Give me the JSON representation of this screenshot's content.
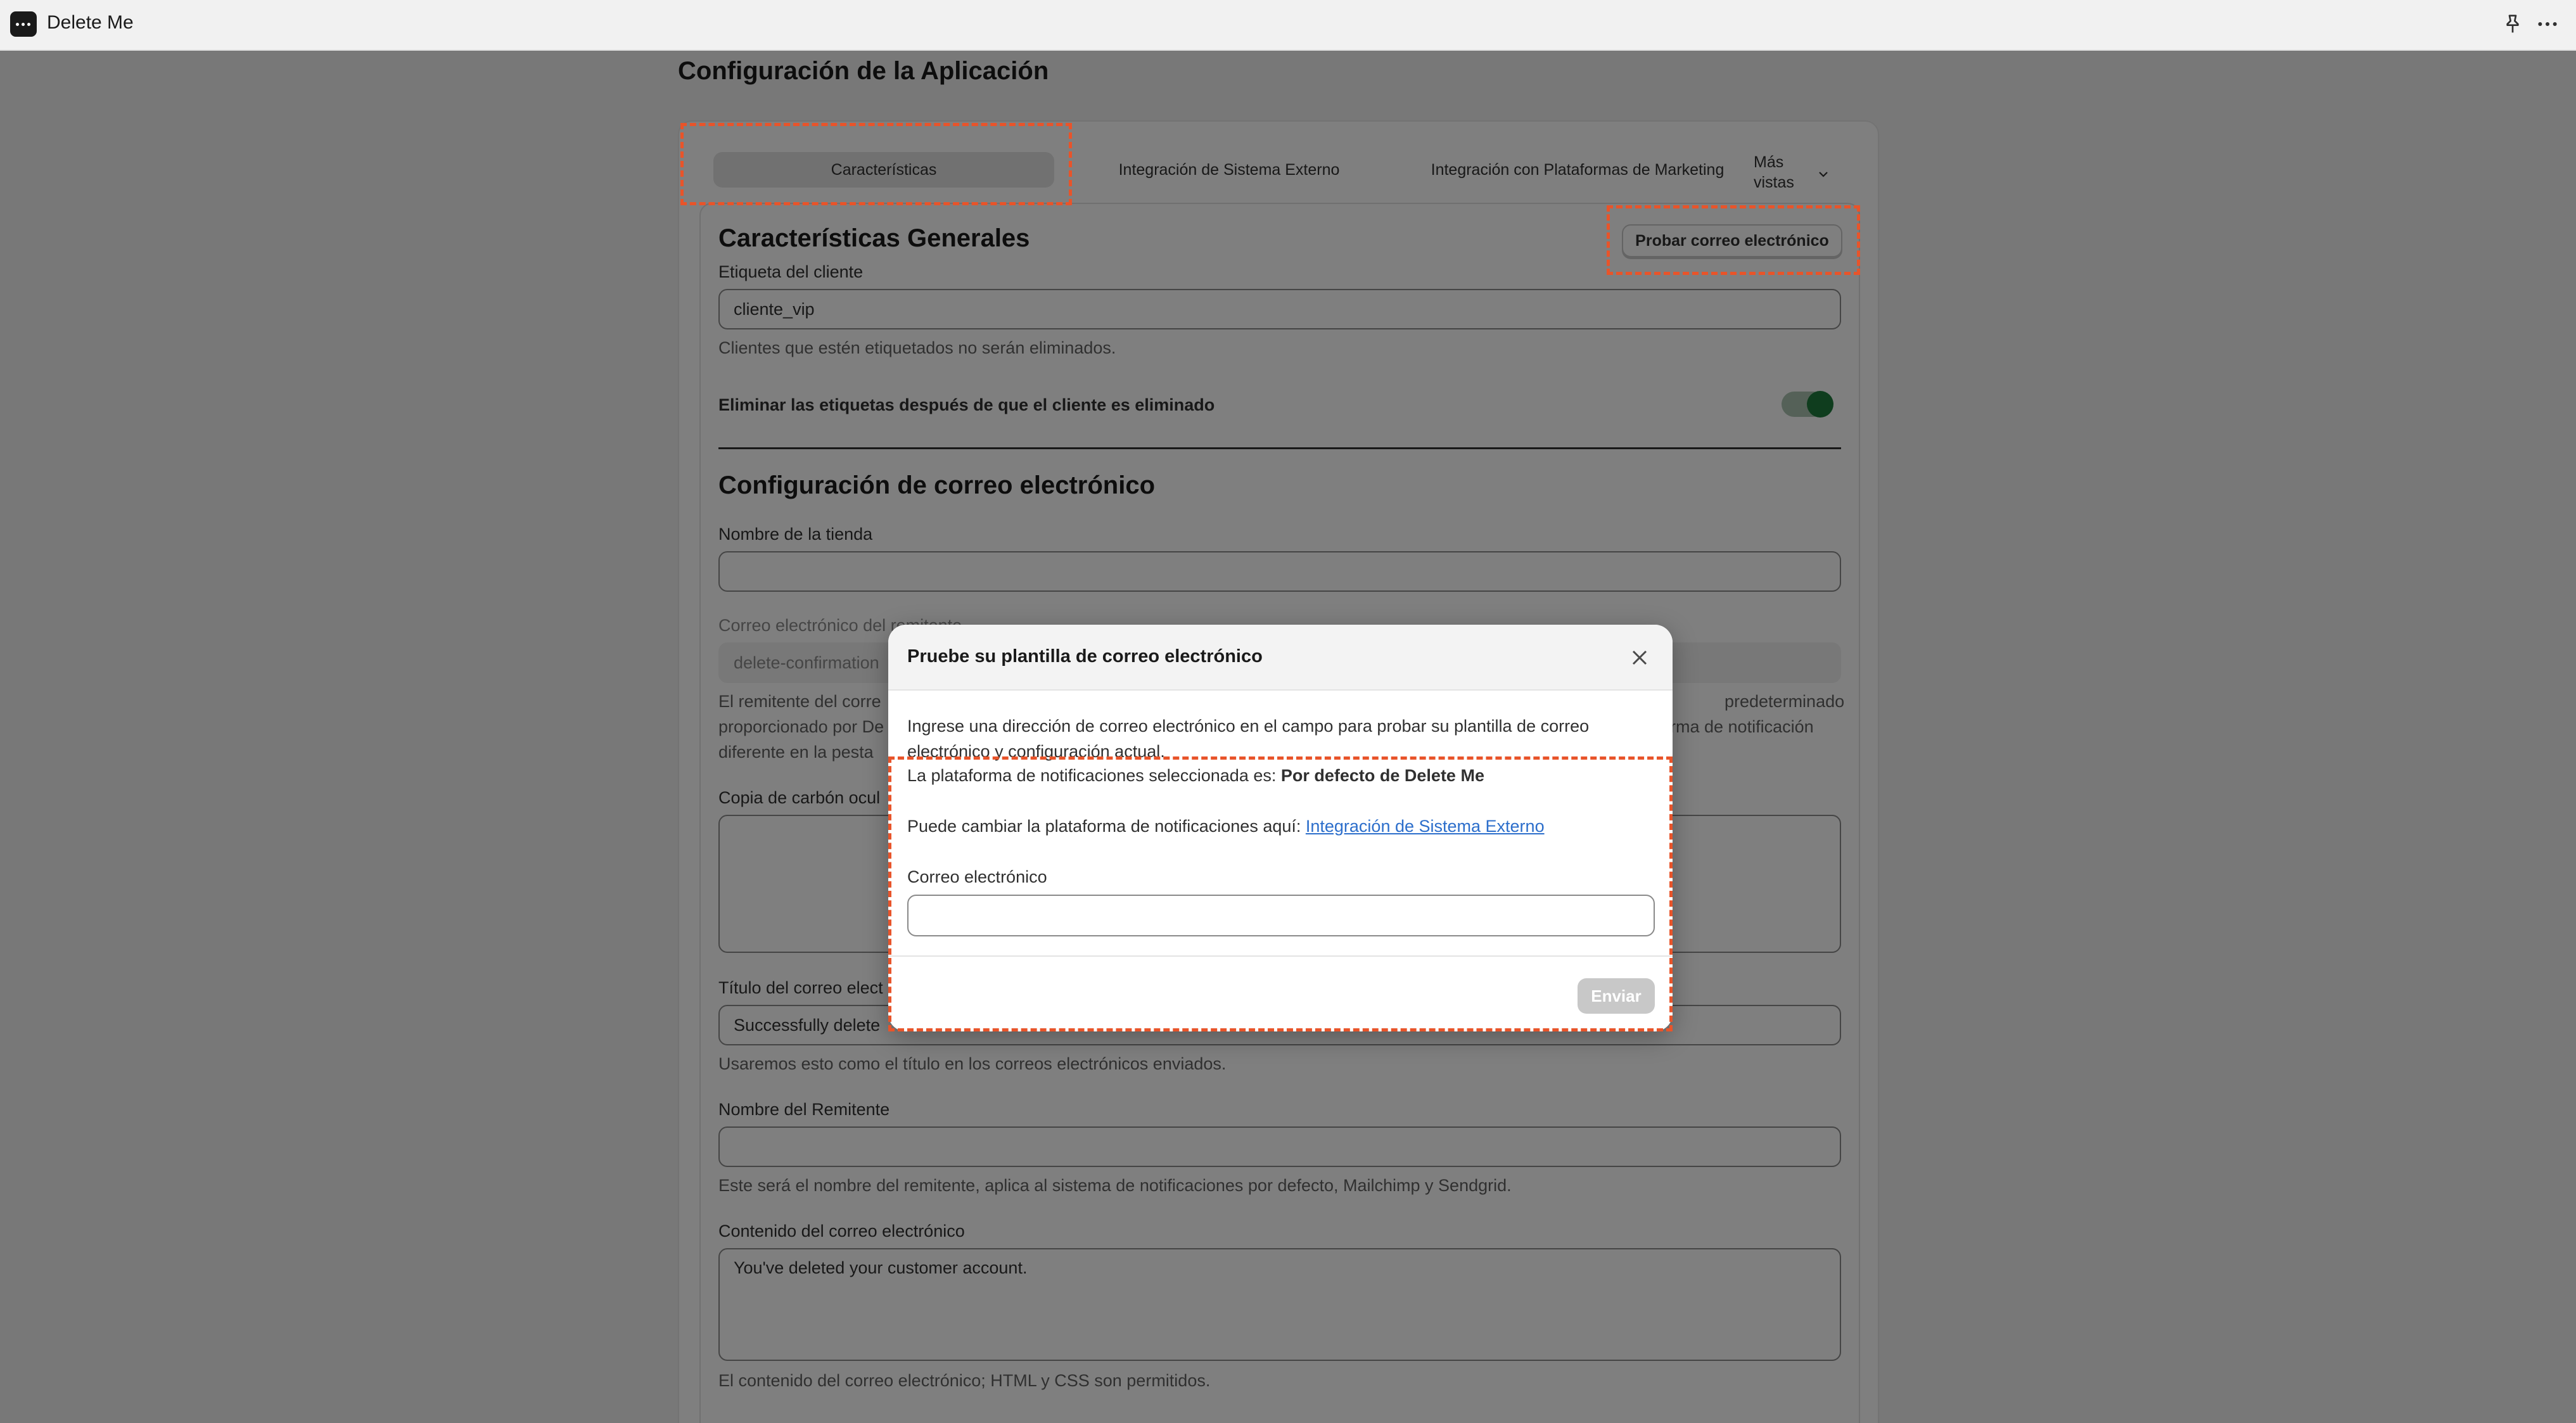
{
  "app": {
    "title": "Delete Me"
  },
  "page": {
    "title": "Configuración de la Aplicación"
  },
  "tabs": [
    {
      "label": "Características"
    },
    {
      "label": "Integración de Sistema Externo"
    },
    {
      "label": "Integración con Plataformas de Marketing"
    },
    {
      "label": "Más vistas"
    }
  ],
  "general": {
    "heading": "Características Generales",
    "test_email_button": "Probar correo electrónico",
    "customer_tag_label": "Etiqueta del cliente",
    "customer_tag_value": "cliente_vip",
    "customer_tag_help": "Clientes que estén etiquetados no serán eliminados.",
    "remove_tags_label": "Eliminar las etiquetas después de que el cliente es eliminado",
    "remove_tags_enabled": true
  },
  "email": {
    "heading": "Configuración de correo electrónico",
    "store_name_label": "Nombre de la tienda",
    "store_name_value": "",
    "sender_email_label": "Correo electrónico del remitente",
    "sender_email_value": "delete-confirmation",
    "sender_help_left_1": "El remitente del corre",
    "sender_help_right_1": "predeterminado",
    "sender_help_left_2": "proporcionado por De",
    "sender_help_right_2": "rma de notificación",
    "sender_help_left_3": "diferente en la pesta",
    "bcc_label": "Copia de carbón ocul",
    "subject_label": "Título del correo elect",
    "subject_value": "Successfully delete",
    "subject_help": "Usaremos esto como el título en los correos electrónicos enviados.",
    "sender_name_label": "Nombre del Remitente",
    "sender_name_value": "",
    "sender_name_help": "Este será el nombre del remitente, aplica al sistema de notificaciones por defecto, Mailchimp y Sendgrid.",
    "content_label": "Contenido del correo electrónico",
    "content_value": "You've deleted your customer account.",
    "content_help": "El contenido del correo electrónico; HTML y CSS son permitidos."
  },
  "modal": {
    "title": "Pruebe su plantilla de correo electrónico",
    "intro": "Ingrese una dirección de correo electrónico en el campo para probar su plantilla de correo electrónico y configuración actual.",
    "platform_prefix": "La plataforma de notificaciones seleccionada es: ",
    "platform_value": "Por defecto de Delete Me",
    "change_prefix": "Puede cambiar la plataforma de notificaciones aquí: ",
    "change_link": "Integración de Sistema Externo",
    "email_label": "Correo electrónico",
    "email_value": "",
    "send_button": "Enviar"
  },
  "colors": {
    "highlight": "#e8542a",
    "toggle_on": "#1f7a3d",
    "link": "#2c6ecb"
  }
}
